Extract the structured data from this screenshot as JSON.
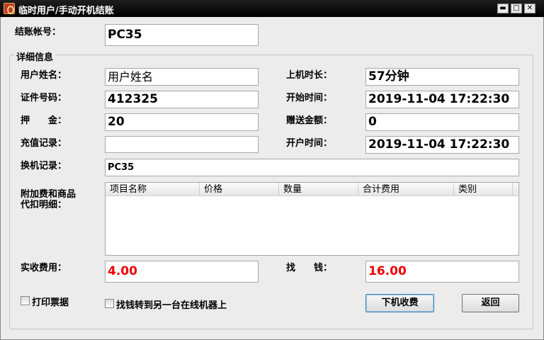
{
  "window": {
    "title": "临时用户/手动开机结账",
    "minimize": "▬",
    "maximize": "□",
    "close": "✕"
  },
  "account": {
    "label": "结账帐号：",
    "value": "PC35"
  },
  "details": {
    "title": "详细信息",
    "user_name": {
      "label": "用户姓名：",
      "value": "用户姓名"
    },
    "id_number": {
      "label": "证件号码：",
      "value": "412325"
    },
    "deposit": {
      "label": "押　　金：",
      "value": "20"
    },
    "recharge": {
      "label": "充值记录：",
      "value": ""
    },
    "swap": {
      "label": "换机记录：",
      "value": "PC35"
    },
    "duration": {
      "label": "上机时长：",
      "value": "57分钟"
    },
    "start_time": {
      "label": "开始时间：",
      "value": "2019-11-04 17:22:30"
    },
    "bonus": {
      "label": "赠送金额：",
      "value": "0"
    },
    "open_time": {
      "label": "开户时间：",
      "value": "2019-11-04 17:22:30"
    },
    "extras_label_1": "附加费和商品",
    "extras_label_2": "代扣明细：",
    "extras_columns": [
      "项目名称",
      "价格",
      "数量",
      "合计费用",
      "类别"
    ]
  },
  "received": {
    "label": "实收费用：",
    "value": "4.00"
  },
  "change": {
    "label": "找　　钱：",
    "value": "16.00"
  },
  "print_receipt": {
    "label": "打印票据",
    "checked": false
  },
  "transfer_change": {
    "label": "找钱转到另一台在线机器上",
    "checked": false
  },
  "buttons": {
    "checkout": "下机收费",
    "back": "返回"
  }
}
